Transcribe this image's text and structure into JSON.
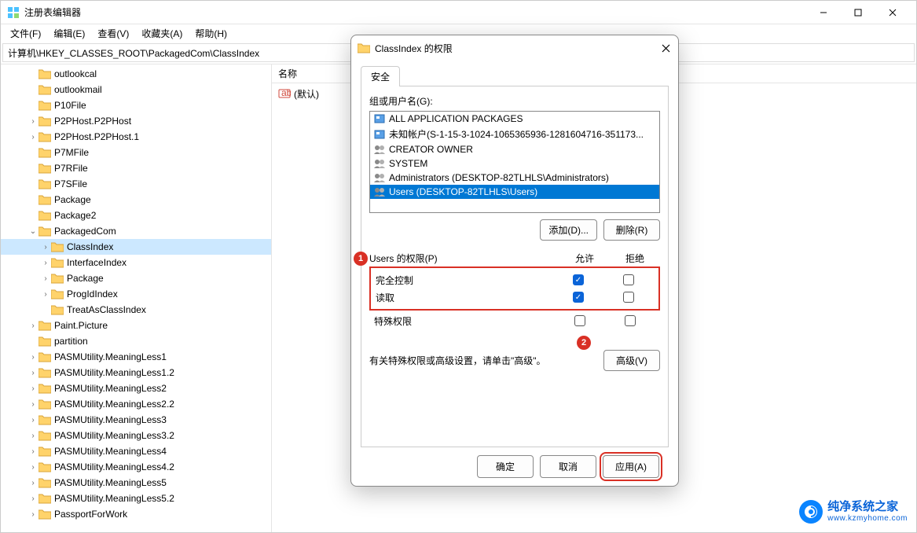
{
  "window": {
    "title": "注册表编辑器"
  },
  "menu": {
    "file": "文件(F)",
    "edit": "编辑(E)",
    "view": "查看(V)",
    "fav": "收藏夹(A)",
    "help": "帮助(H)"
  },
  "address": "计算机\\HKEY_CLASSES_ROOT\\PackagedCom\\ClassIndex",
  "tree": [
    {
      "indent": 28,
      "exp": "",
      "label": "outlookcal"
    },
    {
      "indent": 28,
      "exp": "",
      "label": "outlookmail"
    },
    {
      "indent": 28,
      "exp": "",
      "label": "P10File"
    },
    {
      "indent": 28,
      "exp": ">",
      "label": "P2PHost.P2PHost"
    },
    {
      "indent": 28,
      "exp": ">",
      "label": "P2PHost.P2PHost.1"
    },
    {
      "indent": 28,
      "exp": "",
      "label": "P7MFile"
    },
    {
      "indent": 28,
      "exp": "",
      "label": "P7RFile"
    },
    {
      "indent": 28,
      "exp": "",
      "label": "P7SFile"
    },
    {
      "indent": 28,
      "exp": "",
      "label": "Package"
    },
    {
      "indent": 28,
      "exp": "",
      "label": "Package2"
    },
    {
      "indent": 28,
      "exp": "v",
      "label": "PackagedCom"
    },
    {
      "indent": 44,
      "exp": ">",
      "label": "ClassIndex",
      "selected": true
    },
    {
      "indent": 44,
      "exp": ">",
      "label": "InterfaceIndex"
    },
    {
      "indent": 44,
      "exp": ">",
      "label": "Package"
    },
    {
      "indent": 44,
      "exp": ">",
      "label": "ProgIdIndex"
    },
    {
      "indent": 44,
      "exp": "",
      "label": "TreatAsClassIndex"
    },
    {
      "indent": 28,
      "exp": ">",
      "label": "Paint.Picture"
    },
    {
      "indent": 28,
      "exp": "",
      "label": "partition"
    },
    {
      "indent": 28,
      "exp": ">",
      "label": "PASMUtility.MeaningLess1"
    },
    {
      "indent": 28,
      "exp": ">",
      "label": "PASMUtility.MeaningLess1.2"
    },
    {
      "indent": 28,
      "exp": ">",
      "label": "PASMUtility.MeaningLess2"
    },
    {
      "indent": 28,
      "exp": ">",
      "label": "PASMUtility.MeaningLess2.2"
    },
    {
      "indent": 28,
      "exp": ">",
      "label": "PASMUtility.MeaningLess3"
    },
    {
      "indent": 28,
      "exp": ">",
      "label": "PASMUtility.MeaningLess3.2"
    },
    {
      "indent": 28,
      "exp": ">",
      "label": "PASMUtility.MeaningLess4"
    },
    {
      "indent": 28,
      "exp": ">",
      "label": "PASMUtility.MeaningLess4.2"
    },
    {
      "indent": 28,
      "exp": ">",
      "label": "PASMUtility.MeaningLess5"
    },
    {
      "indent": 28,
      "exp": ">",
      "label": "PASMUtility.MeaningLess5.2"
    },
    {
      "indent": 28,
      "exp": ">",
      "label": "PassportForWork"
    }
  ],
  "list": {
    "header": "名称",
    "default_value": "(默认)"
  },
  "dialog": {
    "title": "ClassIndex 的权限",
    "tab": "安全",
    "group_label": "组或用户名(G):",
    "users": [
      {
        "icon": "pkg",
        "text": "ALL APPLICATION PACKAGES"
      },
      {
        "icon": "pkg",
        "text": "未知帐户(S-1-15-3-1024-1065365936-1281604716-351173..."
      },
      {
        "icon": "grp",
        "text": "CREATOR OWNER"
      },
      {
        "icon": "grp",
        "text": "SYSTEM"
      },
      {
        "icon": "grp",
        "text": "Administrators (DESKTOP-82TLHLS\\Administrators)"
      },
      {
        "icon": "grp",
        "text": "Users (DESKTOP-82TLHLS\\Users)",
        "selected": true
      }
    ],
    "add_btn": "添加(D)...",
    "remove_btn": "删除(R)",
    "perm_label": "Users 的权限(P)",
    "allow_col": "允许",
    "deny_col": "拒绝",
    "perms": [
      {
        "label": "完全控制",
        "allow": true,
        "deny": false
      },
      {
        "label": "读取",
        "allow": true,
        "deny": false
      }
    ],
    "extra_perm": {
      "label": "特殊权限",
      "allow": false,
      "deny": false
    },
    "adv_text": "有关特殊权限或高级设置，请单击\"高级\"。",
    "adv_btn": "高级(V)",
    "ok": "确定",
    "cancel": "取消",
    "apply": "应用(A)"
  },
  "annotations": {
    "a1": "1",
    "a2": "2"
  },
  "watermark": {
    "title": "纯净系统之家",
    "url": "www.kzmyhome.com"
  }
}
